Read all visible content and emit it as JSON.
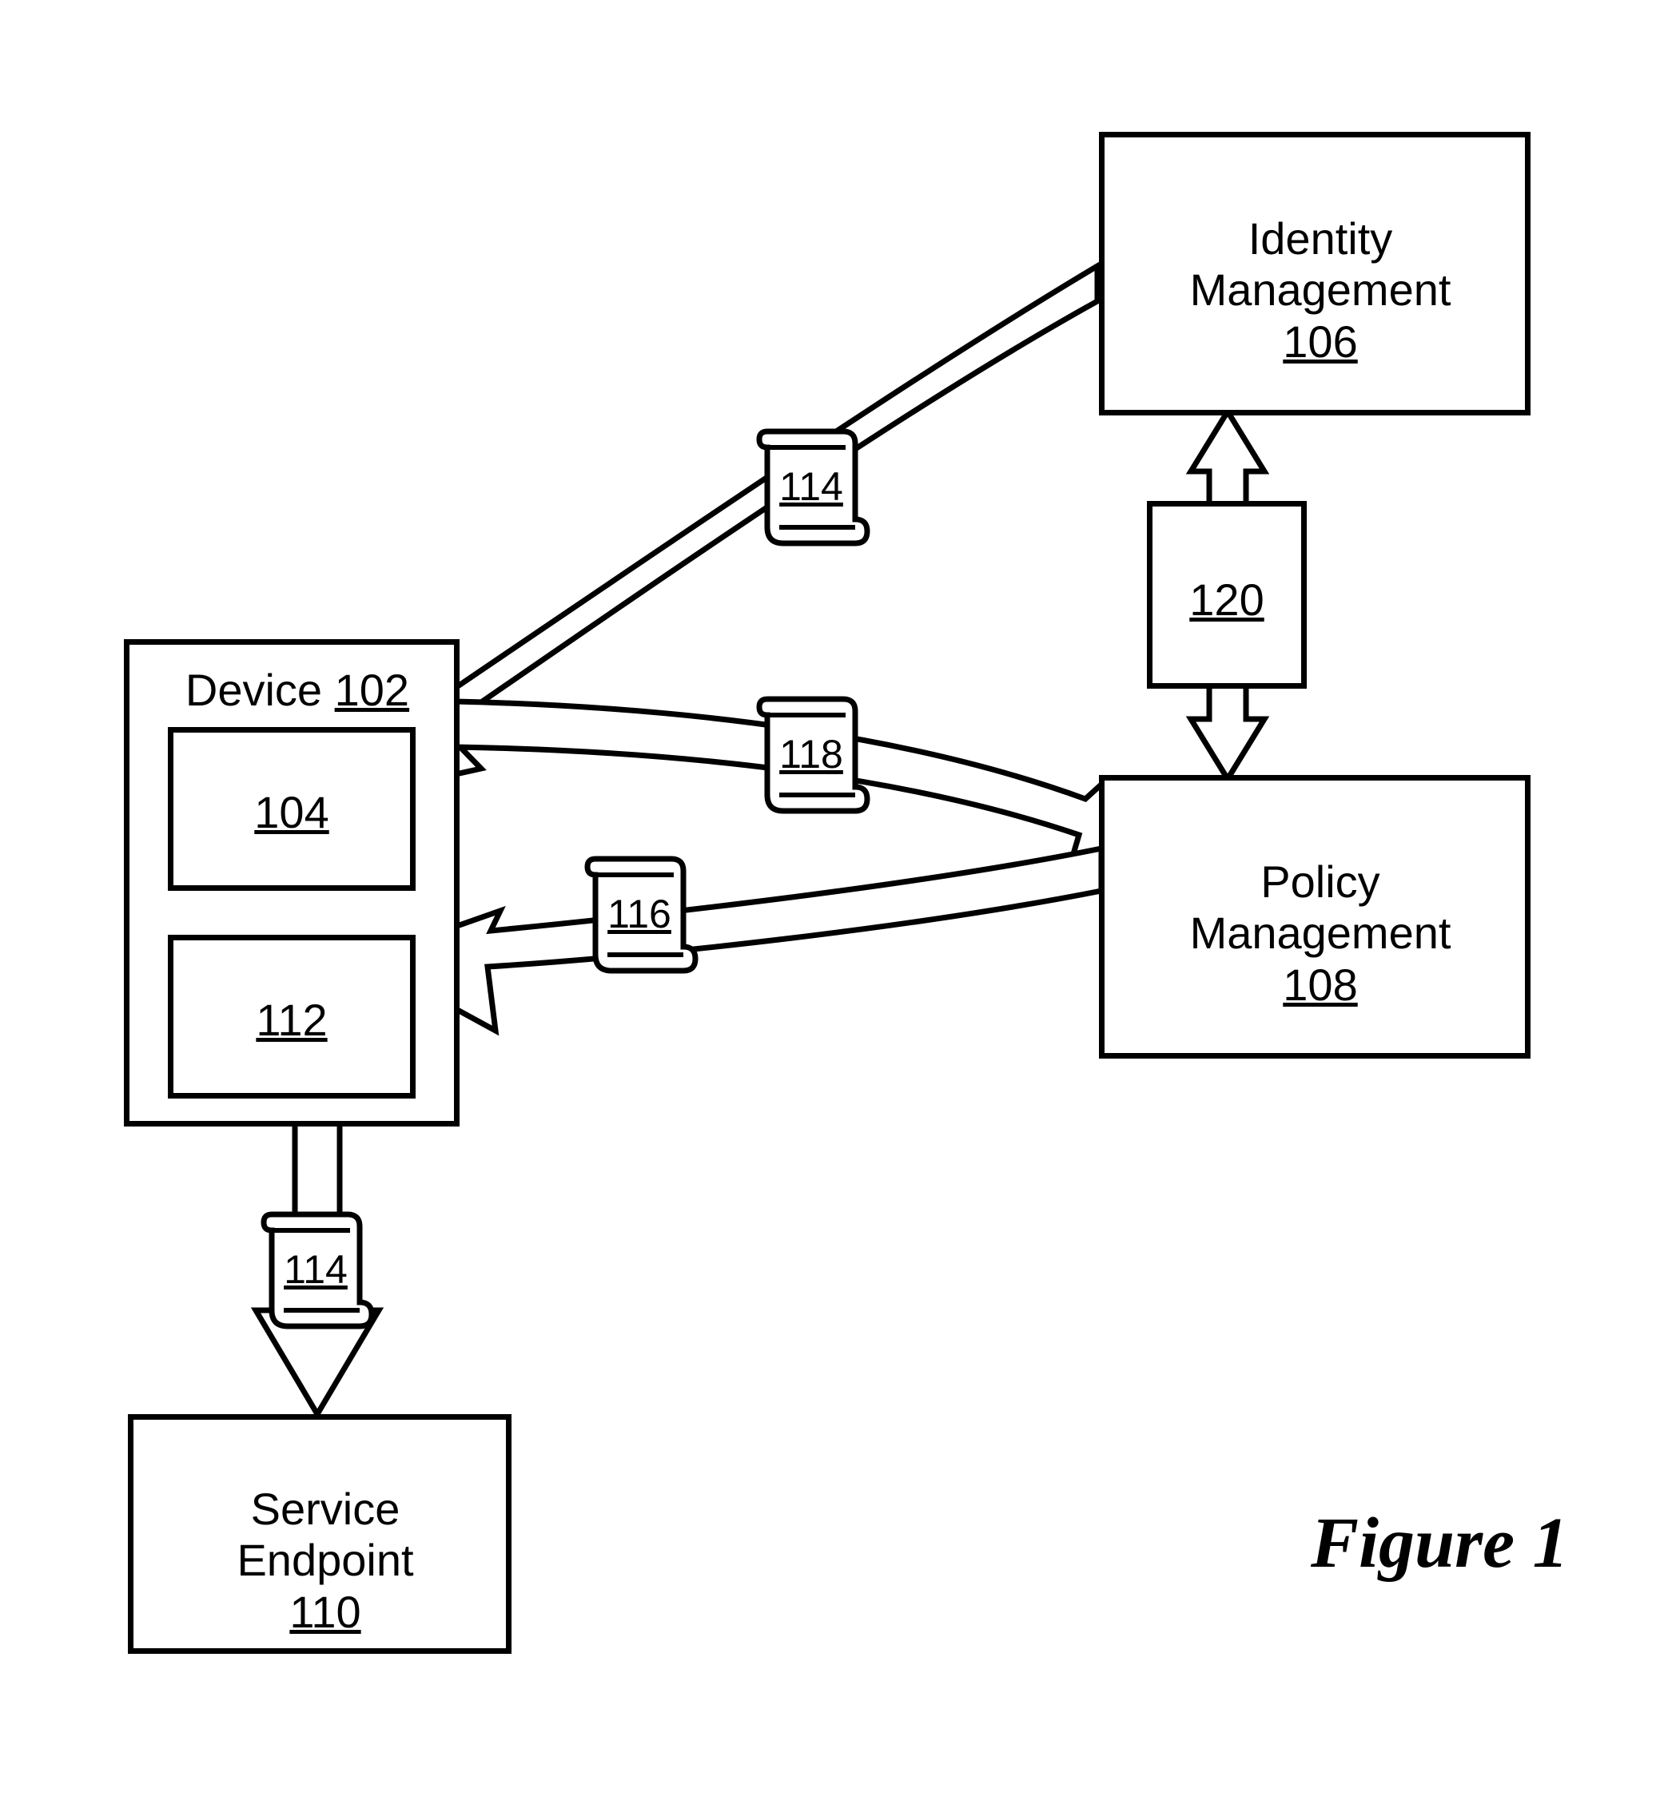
{
  "figure_label": "Figure 1",
  "boxes": {
    "device": {
      "title": "Device",
      "ref": "102"
    },
    "device_inner_top": {
      "ref": "104"
    },
    "device_inner_bot": {
      "ref": "112"
    },
    "identity": {
      "title": "Identity Management",
      "ref": "106"
    },
    "policy": {
      "title": "Policy Management",
      "ref": "108"
    },
    "link_box": {
      "ref": "120"
    },
    "service": {
      "title": "Service Endpoint",
      "ref": "110"
    }
  },
  "scrolls": {
    "s114a": "114",
    "s118": "118",
    "s116": "116",
    "s114b": "114"
  }
}
